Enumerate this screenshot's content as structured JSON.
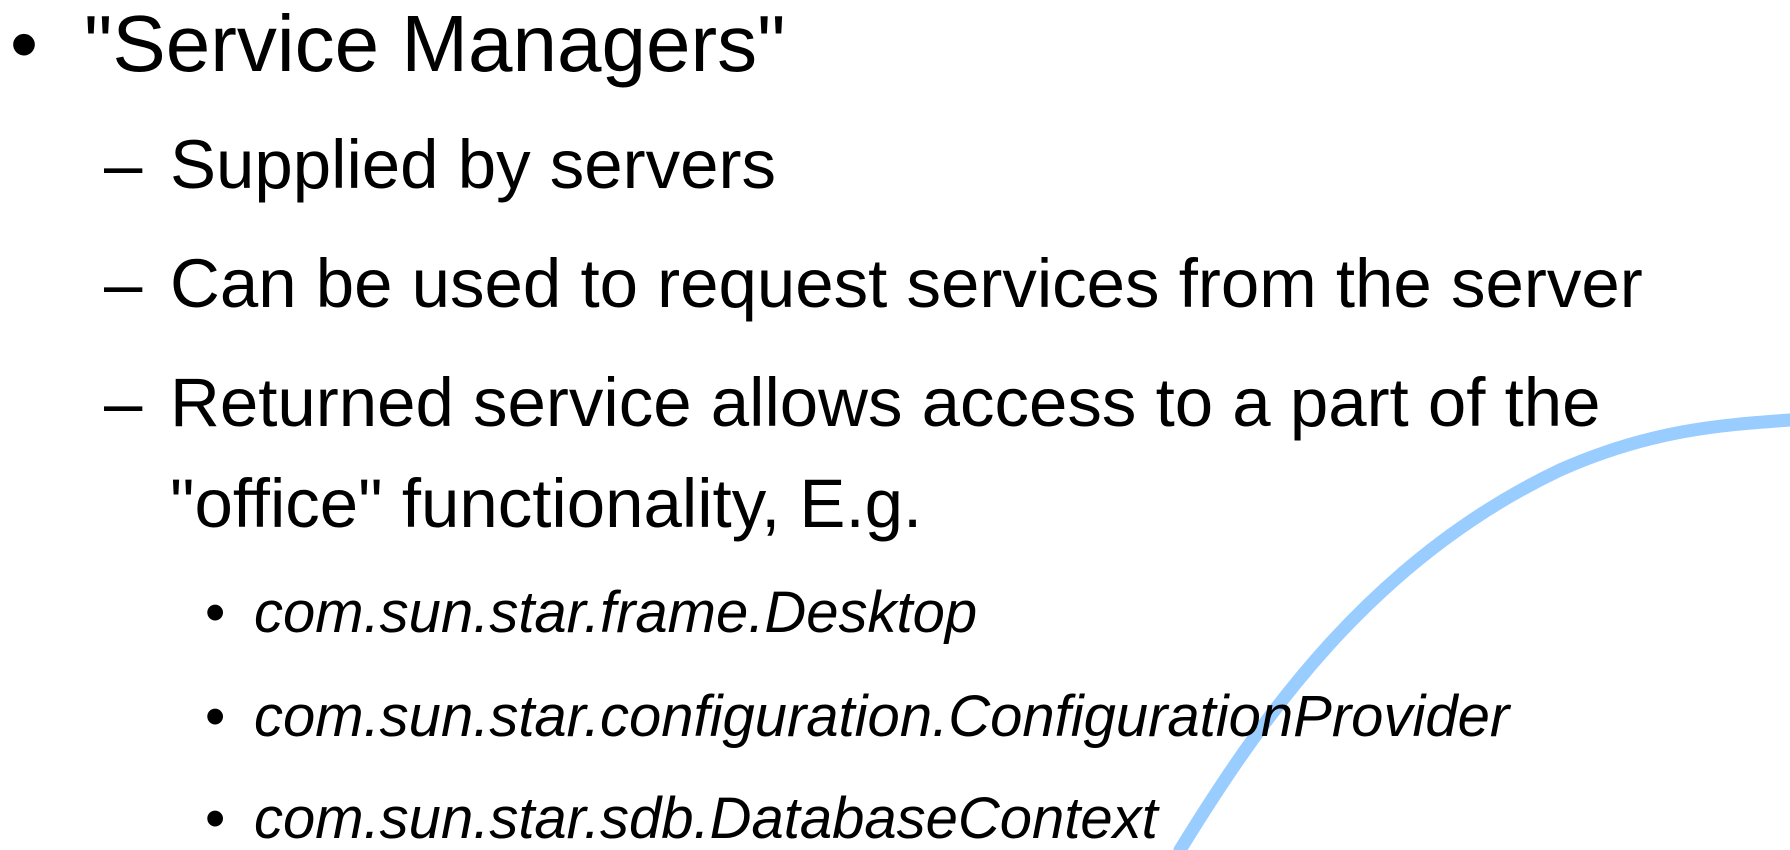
{
  "slide": {
    "accent_color": "#99ccff",
    "level1": {
      "bullet": "•",
      "text": "\"Service Managers\""
    },
    "level2": [
      {
        "dash": "–",
        "lines": [
          "Supplied by servers"
        ]
      },
      {
        "dash": "–",
        "lines": [
          "Can be used to request services from the server"
        ]
      },
      {
        "dash": "–",
        "lines": [
          "Returned service allows access to a part of the",
          "\"office\" functionality, E.g."
        ]
      }
    ],
    "level3": [
      {
        "bullet": "•",
        "text": "com.sun.star.frame.Desktop"
      },
      {
        "bullet": "•",
        "text": "com.sun.star.configuration.ConfigurationProvider"
      },
      {
        "bullet": "•",
        "text": "com.sun.star.sdb.DatabaseContext"
      }
    ]
  }
}
